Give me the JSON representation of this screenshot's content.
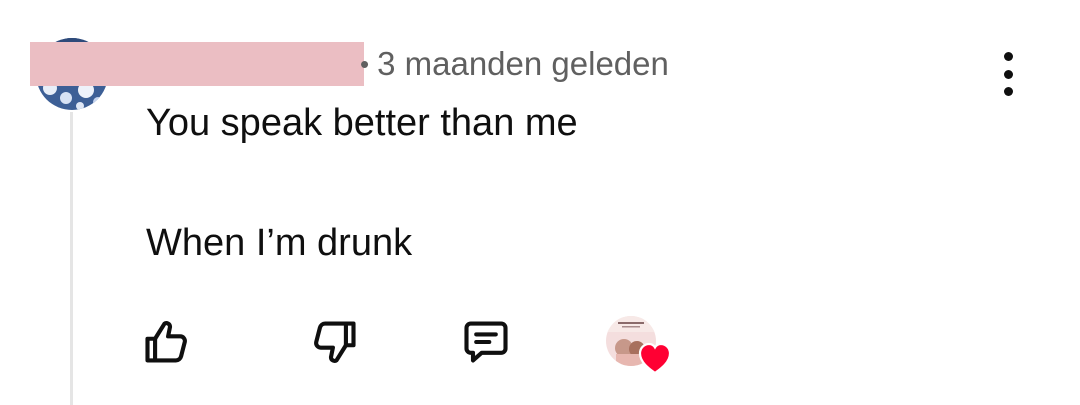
{
  "comment": {
    "timestamp": "3 maanden geleden",
    "separator": "•",
    "lines": [
      "You speak better than me",
      "When I’m drunk"
    ]
  },
  "actions": {
    "like_icon": "thumbs-up-icon",
    "dislike_icon": "thumbs-down-icon",
    "reply_icon": "comment-icon",
    "more_icon": "more-vert-icon",
    "creator_heart_icon": "heart-icon"
  },
  "colors": {
    "text": "#0f0f0f",
    "secondary_text": "#606060",
    "thread_line": "#e5e5e5",
    "redaction": "#ebbec3",
    "heart": "#ff0033"
  }
}
